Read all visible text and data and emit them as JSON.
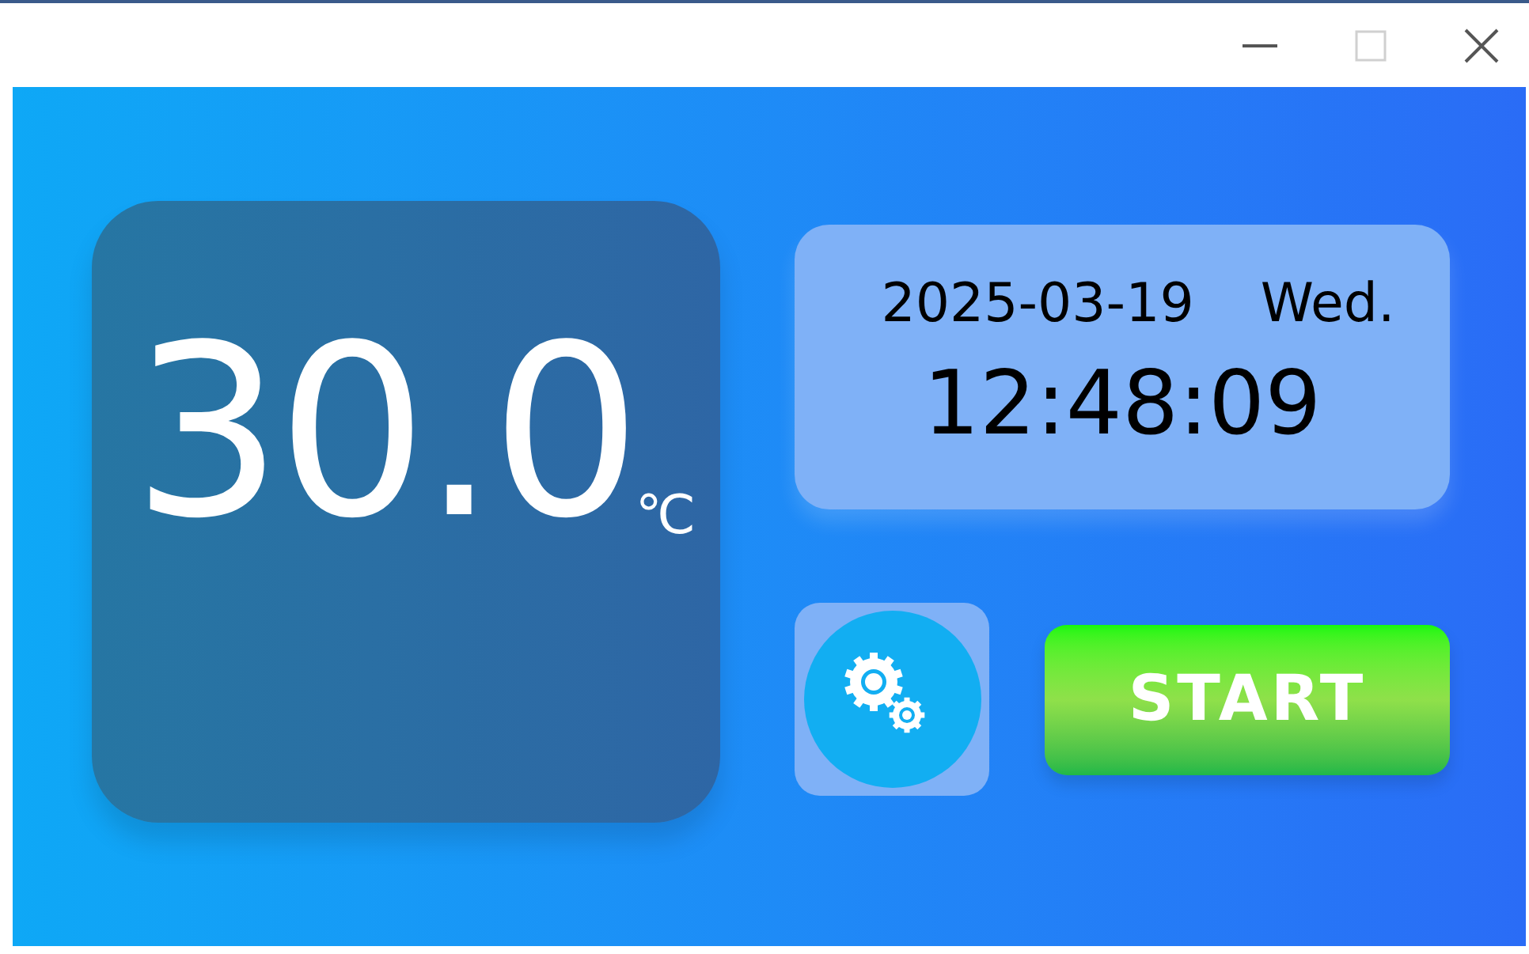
{
  "window": {
    "maximize_disabled": true
  },
  "temperature": {
    "value": "30.0",
    "unit": "℃"
  },
  "clock": {
    "date": "2025-03-19",
    "weekday": "Wed.",
    "time": "12:48:09"
  },
  "start_button": {
    "label": "START"
  }
}
